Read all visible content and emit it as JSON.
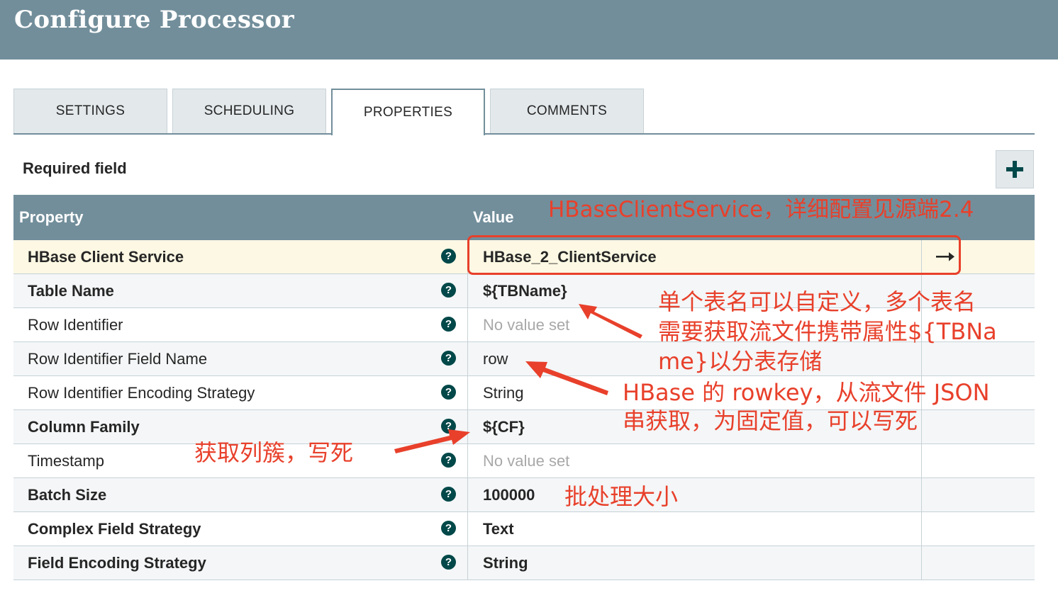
{
  "header": {
    "title": "Configure Processor"
  },
  "tabs": [
    {
      "label": "SETTINGS",
      "active": false
    },
    {
      "label": "SCHEDULING",
      "active": false
    },
    {
      "label": "PROPERTIES",
      "active": true
    },
    {
      "label": "COMMENTS",
      "active": false
    }
  ],
  "required_label": "Required field",
  "add_icon": "plus-icon",
  "grid": {
    "col_property": "Property",
    "col_value": "Value",
    "rows": [
      {
        "name": "HBase Client Service",
        "value": "HBase_2_ClientService"
      },
      {
        "name": "Table Name",
        "value": "${TBName}"
      },
      {
        "name": "Row Identifier",
        "value": "No value set"
      },
      {
        "name": "Row Identifier Field Name",
        "value": "row"
      },
      {
        "name": "Row Identifier Encoding Strategy",
        "value": "String"
      },
      {
        "name": "Column Family",
        "value": "${CF}"
      },
      {
        "name": "Timestamp",
        "value": "No value set"
      },
      {
        "name": "Batch Size",
        "value": "100000"
      },
      {
        "name": "Complex Field Strategy",
        "value": "Text"
      },
      {
        "name": "Field Encoding Strategy",
        "value": "String"
      }
    ],
    "help_glyph": "?",
    "goto_icon": "arrow-right-icon"
  },
  "annotations": {
    "client_service": "HBaseClientService，详细配置见源端2.4",
    "table_name_1": "单个表名可以自定义，多个表名",
    "table_name_2": "需要获取流文件携带属性${TBNa",
    "table_name_3": "me}以分表存储",
    "rowkey_1": "HBase 的 rowkey，从流文件 JSON",
    "rowkey_2": "串获取，为固定值，可以写死",
    "column_family": "获取列簇，写死",
    "batch_size": "批处理大小",
    "color": "#e8402b"
  }
}
